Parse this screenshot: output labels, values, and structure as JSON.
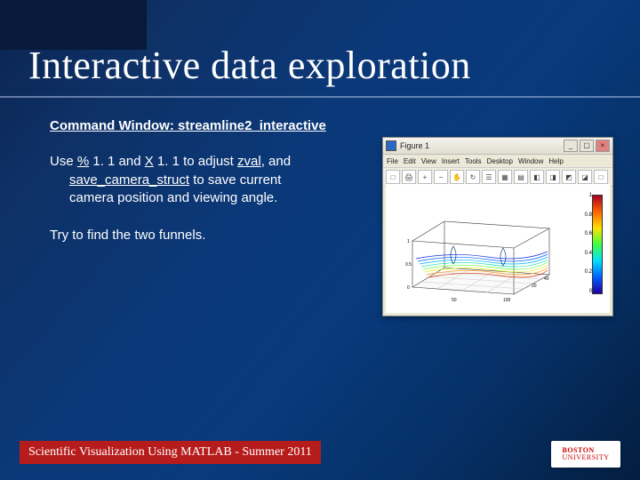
{
  "title": "Interactive data exploration",
  "content": {
    "command_line_label": "Command Window:",
    "command_line_cmd": "streamline2_interactive",
    "para1_pre": "Use ",
    "key1": "%",
    "incr1": " 1. 1 and ",
    "key2": "X",
    "incr2": " 1. 1 to adjust ",
    "var1": "zval",
    "mid1": ", and",
    "func1": "save_camera_struct",
    "mid2": " to save current",
    "mid3": "camera position and viewing angle.",
    "para2": "Try to find the two funnels."
  },
  "figure": {
    "window_title": "Figure 1",
    "menus": [
      "File",
      "Edit",
      "View",
      "Insert",
      "Tools",
      "Desktop",
      "Window",
      "Help"
    ],
    "toolbar_icons": [
      "□",
      "🖨",
      "+",
      "−",
      "✋",
      "↻",
      "☰",
      "▦",
      "▤",
      "◧",
      "◨",
      "◩",
      "◪",
      "□"
    ],
    "colorbar_ticks": [
      "1",
      "0.8",
      "0.6",
      "0.4",
      "0.2",
      "0"
    ]
  },
  "footer": "Scientific Visualization Using MATLAB - Summer 2011",
  "logo": {
    "line1": "BOSTON",
    "line2": "UNIVERSITY"
  }
}
